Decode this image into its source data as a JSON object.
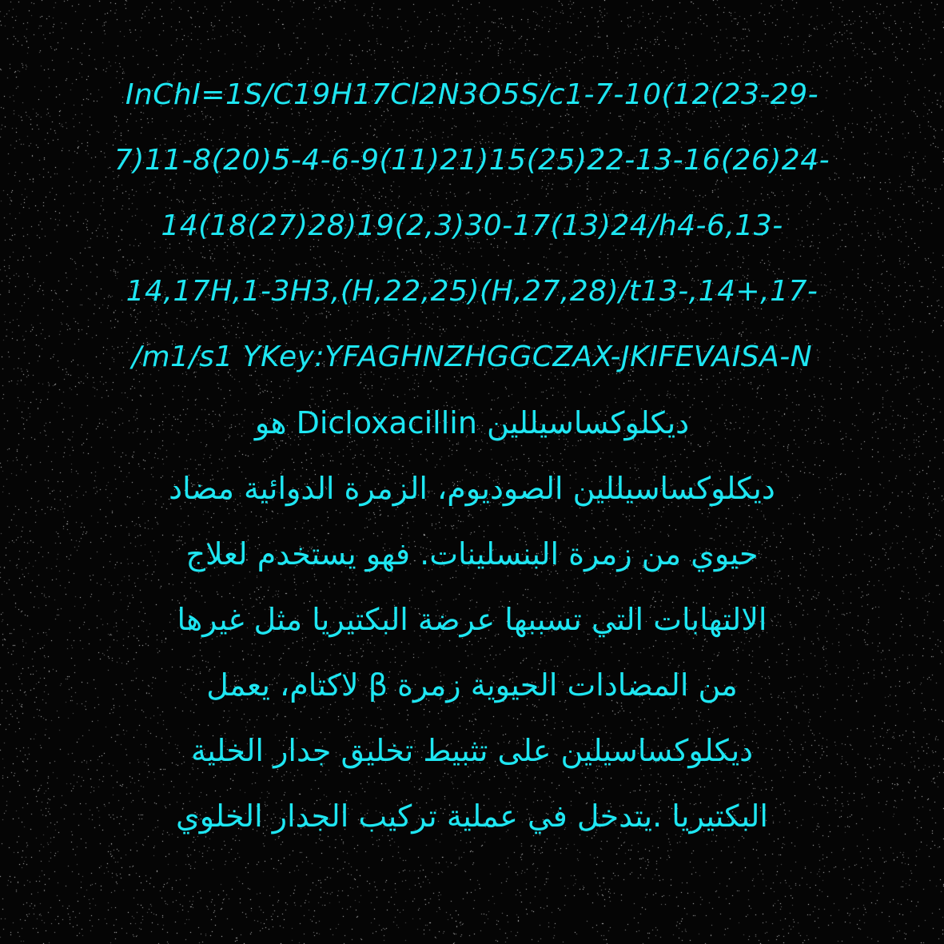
{
  "lines": [
    "InChI=1S/C19H17Cl2N3O5S/c1-7-10(12(23-29-",
    "7)11-8(20)5-4-6-9(11)21)15(25)22-13-16(26)24-",
    "14(18(27)28)19(2,3)30-17(13)24/h4-6,13-",
    "14,17H,1-3H3,(H,22,25)(H,27,28)/t13-,14+,17-",
    "/m1/s1 YKey:YFAGHNZHGGCZAX-JKIFEVAISA-N",
    "ديكلوكساسيللين Dicloxacillin هو",
    "ديكلوكساسيللين الصوديوم، الزمرة الدوائية مضاد",
    "حيوي من زمرة البنسلينات. فهو يستخدم لعلاج",
    "الالتهابات التي تسببها عرضة البكتيريا مثل غيرها",
    "من المضادات الحيوية زمرة β لاكتام، يعمل",
    "ديكلوكساسيلين على تثبيط تخليق جدار الخلية",
    "البكتيريا .يتدخل في عملية تركيب الجدار الخلوي"
  ],
  "colors": {
    "text": "#1ee6f2",
    "background": "#050505",
    "noise": "#bdbdbd"
  }
}
